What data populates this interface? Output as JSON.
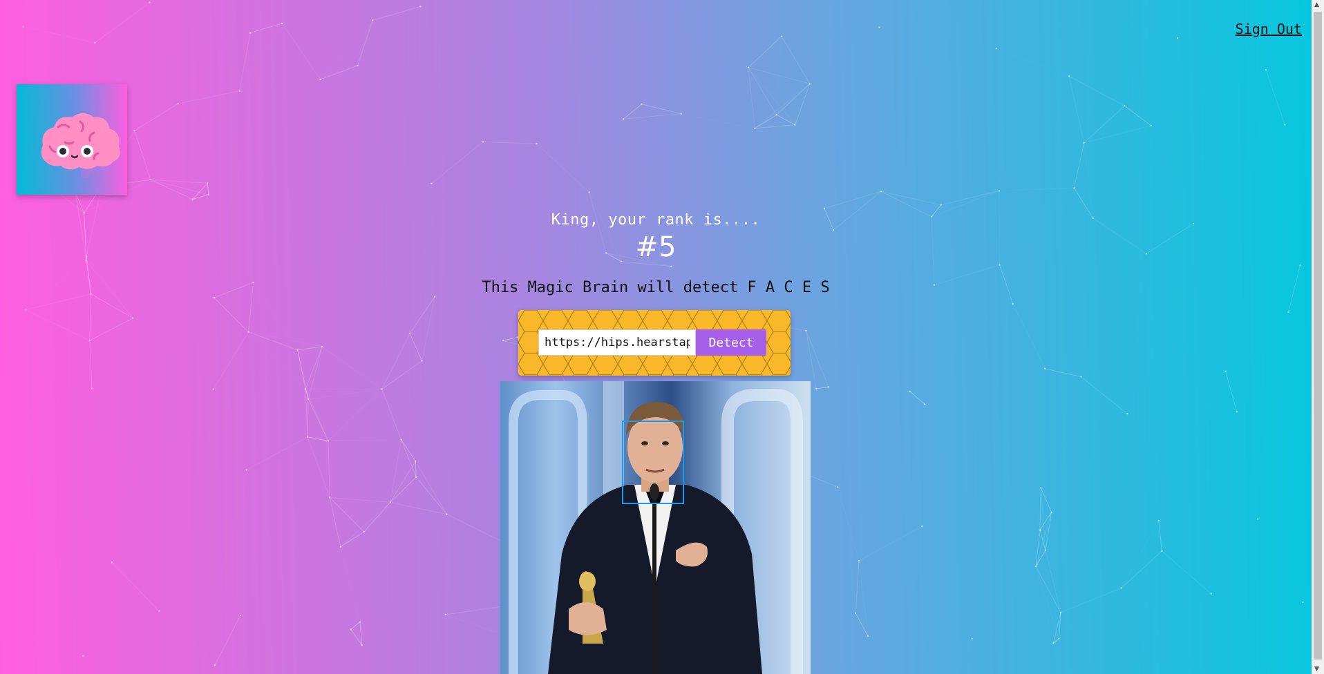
{
  "nav": {
    "signout_label": "Sign Out"
  },
  "logo": {
    "icon": "brain-icon"
  },
  "rank": {
    "label": "King, your rank is....",
    "value": "#5"
  },
  "tagline": "This Magic Brain will detect F A C E S",
  "form": {
    "url_value": "https://hips.hearstapps.com/hmg-prod/images/leonardo-dicaprio.jpg",
    "detect_label": "Detect"
  },
  "image": {
    "face_detected": true,
    "face_box_color": "#149df2"
  },
  "colors": {
    "gradient_left": "#ff5edf",
    "gradient_right": "#04c8de",
    "button": "#a55eea",
    "form_bg": "#f8b82a"
  }
}
